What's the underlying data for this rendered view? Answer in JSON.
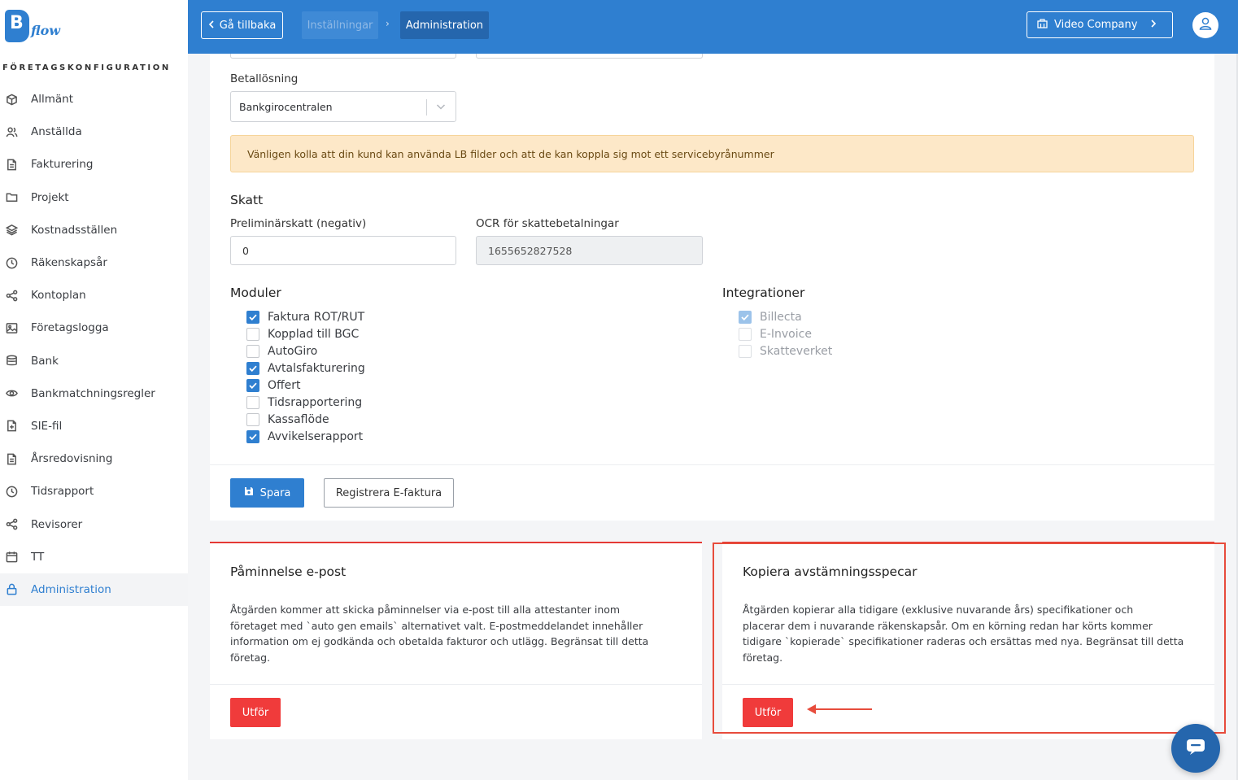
{
  "sidebar": {
    "logo_letter": "B",
    "logo_text": "flow",
    "section_title": "FÖRETAGSKONFIGURATION",
    "items": [
      {
        "label": "Allmänt",
        "icon": "cube-icon"
      },
      {
        "label": "Anställda",
        "icon": "users-icon"
      },
      {
        "label": "Fakturering",
        "icon": "document-icon"
      },
      {
        "label": "Projekt",
        "icon": "folder-icon"
      },
      {
        "label": "Kostnadsställen",
        "icon": "layers-icon"
      },
      {
        "label": "Räkenskapsår",
        "icon": "clock-icon"
      },
      {
        "label": "Kontoplan",
        "icon": "share-icon"
      },
      {
        "label": "Företagslogga",
        "icon": "image-icon"
      },
      {
        "label": "Bank",
        "icon": "database-icon"
      },
      {
        "label": "Bankmatchningsregler",
        "icon": "eye-icon"
      },
      {
        "label": "SIE-fil",
        "icon": "file-plus-icon"
      },
      {
        "label": "Årsredovisning",
        "icon": "document-icon"
      },
      {
        "label": "Tidsrapport",
        "icon": "clock-icon"
      },
      {
        "label": "Revisorer",
        "icon": "share-icon"
      },
      {
        "label": "TT",
        "icon": "calendar-icon"
      },
      {
        "label": "Administration",
        "icon": "lock-icon",
        "active": true
      }
    ]
  },
  "header": {
    "back_label": "Gå tillbaka",
    "crumb_settings": "Inställningar",
    "crumb_admin": "Administration",
    "company_label": "Video Company"
  },
  "form": {
    "payment_label": "Betallösning",
    "payment_value": "Bankgirocentralen",
    "alert_text": "Vänligen kolla att din kund kan använda LB filder och att de kan koppla sig mot ett servicebyrånummer",
    "tax_title": "Skatt",
    "prelim_label": "Preliminärskatt (negativ)",
    "prelim_value": "0",
    "ocr_label": "OCR för skattebetalningar",
    "ocr_value": "1655652827528",
    "modules_title": "Moduler",
    "modules": [
      {
        "label": "Faktura ROT/RUT",
        "checked": true
      },
      {
        "label": "Kopplad till BGC",
        "checked": false
      },
      {
        "label": "AutoGiro",
        "checked": false
      },
      {
        "label": "Avtalsfakturering",
        "checked": true
      },
      {
        "label": "Offert",
        "checked": true
      },
      {
        "label": "Tidsrapportering",
        "checked": false
      },
      {
        "label": "Kassaflöde",
        "checked": false
      },
      {
        "label": "Avvikelserapport",
        "checked": true
      }
    ],
    "integrations_title": "Integrationer",
    "integrations": [
      {
        "label": "Billecta",
        "checked": true
      },
      {
        "label": "E-Invoice",
        "checked": false
      },
      {
        "label": "Skatteverket",
        "checked": false
      }
    ],
    "save_label": "Spara",
    "register_label": "Registrera E-faktura"
  },
  "actions": {
    "reminder": {
      "title": "Påminnelse e-post",
      "desc_lines": [
        "Åtgärden kommer att skicka påminnelser via e-post till alla attestanter inom",
        "företaget med `auto gen emails` alternativet valt. E-postmeddelandet innehåller",
        "information om ej godkända och obetalda fakturor och utlägg. Begränsat till detta",
        "företag."
      ],
      "run_label": "Utför"
    },
    "copy": {
      "title": "Kopiera avstämningsspecar",
      "desc_lines": [
        "Åtgärden kopierar alla tidigare (exklusive nuvarande års) specifikationer och",
        "placerar dem i nuvarande räkenskapsår. Om en körning redan har körts kommer",
        "tidigare `kopierade` specifikationer raderas och ersättas med nya. Begränsat till detta",
        "företag."
      ],
      "run_label": "Utför"
    }
  },
  "colors": {
    "brand": "#2f7fd0",
    "danger": "#f03b3b",
    "annotation": "#e74c3c"
  }
}
